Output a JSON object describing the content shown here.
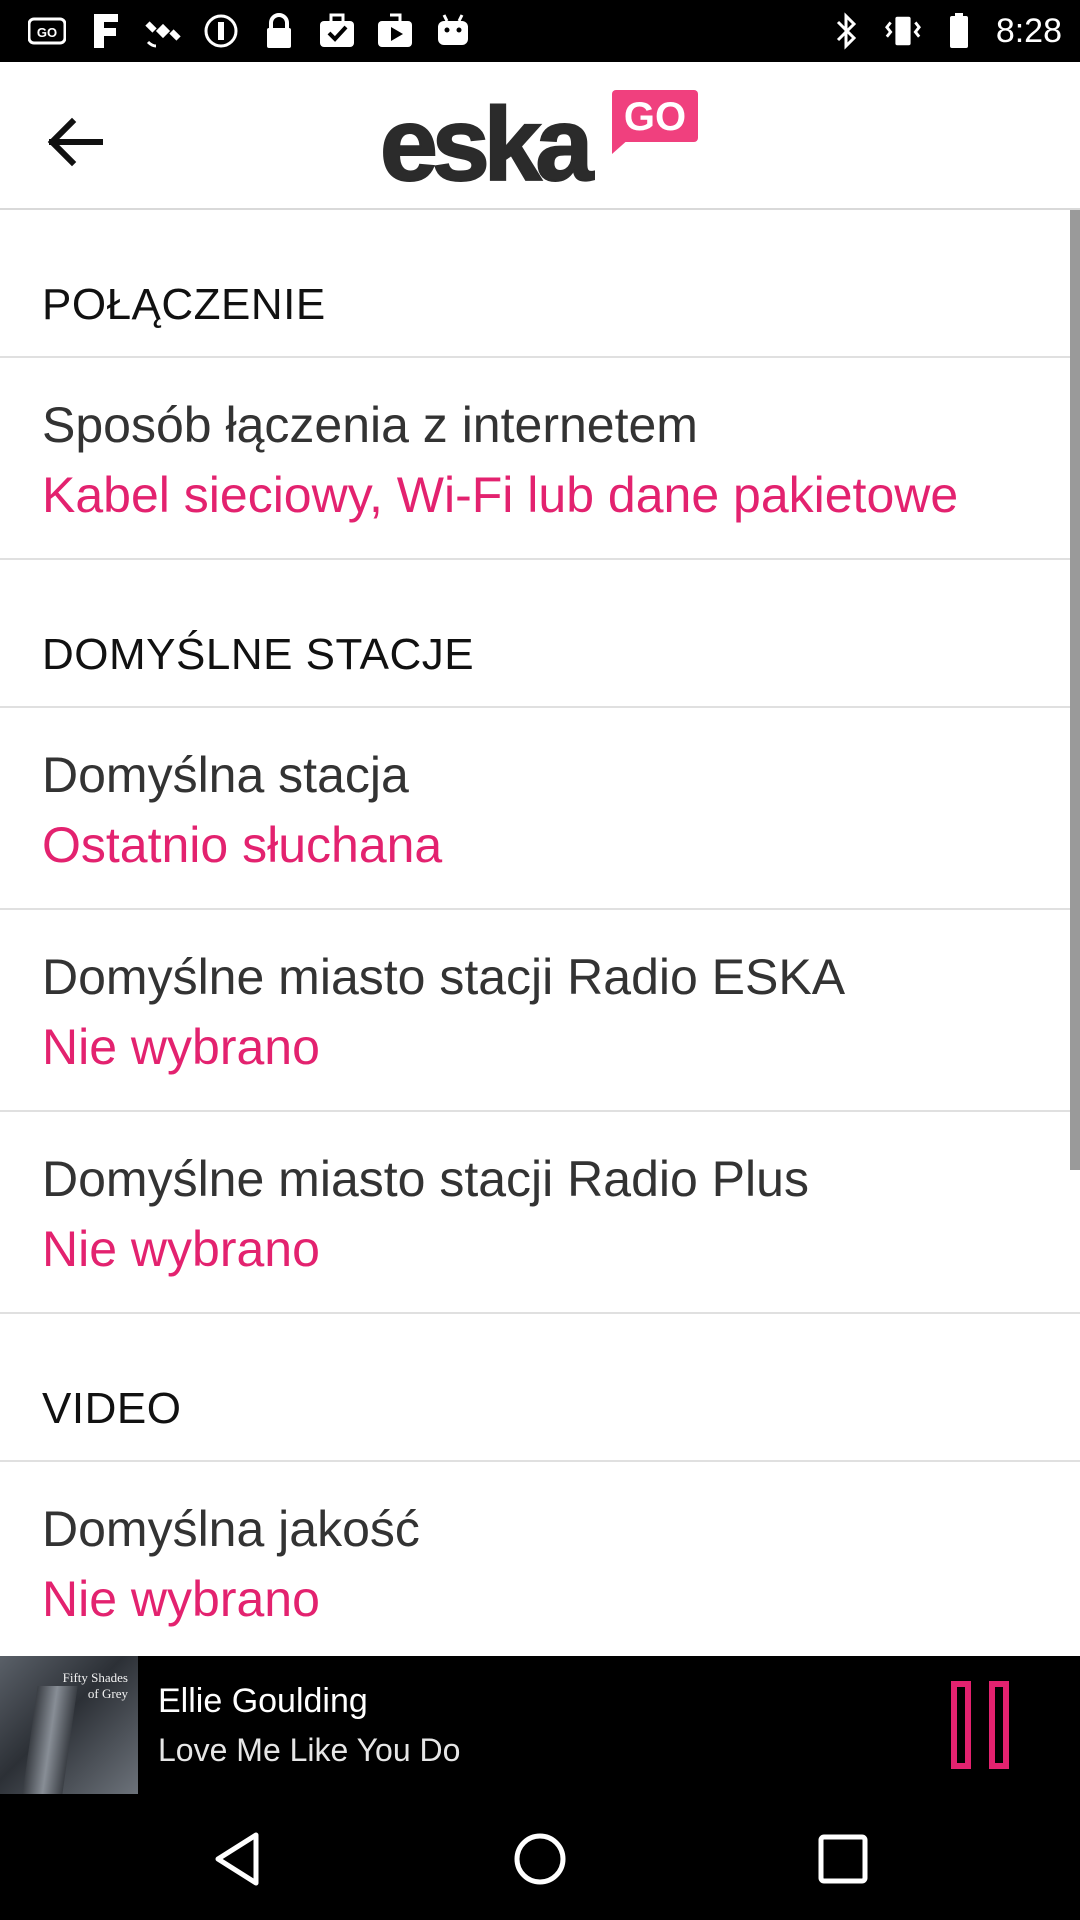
{
  "status_bar": {
    "time": "8:28",
    "left_icons": [
      "go-icon",
      "fake-gps-icon",
      "satellite-icon",
      "sync-icon",
      "lock-icon",
      "briefcase-check-icon",
      "play-store-icon",
      "android-icon"
    ],
    "right_icons": [
      "bluetooth-icon",
      "vibrate-icon",
      "battery-icon"
    ]
  },
  "app_bar": {
    "logo_text": "eska",
    "logo_badge": "GO",
    "back_icon": "arrow-left-icon"
  },
  "colors": {
    "accent": "#e3226f",
    "logo_dark": "#2b2b2b",
    "logo_badge": "#f0407e"
  },
  "sections": [
    {
      "header": "POŁĄCZENIE",
      "items": [
        {
          "title": "Sposób łączenia z internetem",
          "summary": "Kabel sieciowy, Wi-Fi lub dane pakietowe"
        }
      ]
    },
    {
      "header": "DOMYŚLNE STACJE",
      "items": [
        {
          "title": "Domyślna stacja",
          "summary": "Ostatnio słuchana"
        },
        {
          "title": "Domyślne miasto stacji Radio ESKA",
          "summary": "Nie wybrano"
        },
        {
          "title": "Domyślne miasto stacji Radio Plus",
          "summary": "Nie wybrano"
        }
      ]
    },
    {
      "header": "VIDEO",
      "items": [
        {
          "title": "Domyślna jakość",
          "summary": "Nie wybrano"
        }
      ]
    }
  ],
  "player": {
    "album_art_text": "Fifty Shades of Grey",
    "artist": "Ellie Goulding",
    "track": "Love Me Like You Do",
    "pause_icon": "pause-icon"
  },
  "nav_bar": {
    "icons": [
      "back-triangle-icon",
      "home-circle-icon",
      "recents-square-icon"
    ]
  }
}
